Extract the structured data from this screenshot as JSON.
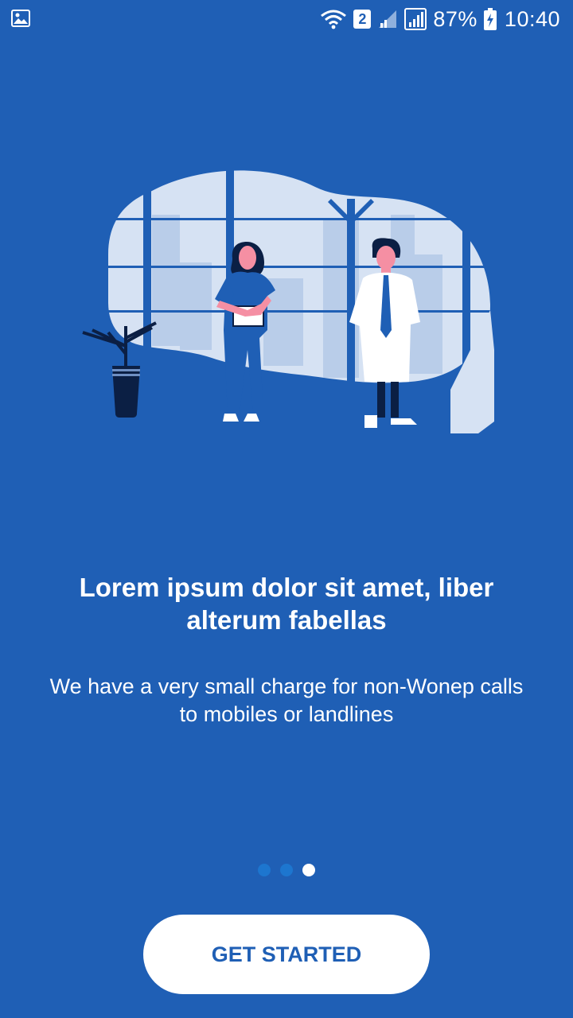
{
  "status_bar": {
    "sim_badge": "2",
    "battery_percent": "87%",
    "time": "10:40",
    "icons": [
      "gallery-icon",
      "wifi-icon",
      "signal-icon",
      "battery-icon"
    ]
  },
  "onboarding": {
    "title": "Lorem ipsum dolor sit amet, liber alterum fabellas",
    "description": "We have a very small charge for non-Wonep calls to mobiles or landlines",
    "page_count": 3,
    "active_page": 3,
    "cta_label": "GET STARTED"
  },
  "colors": {
    "background": "#1f5fb5",
    "accent_white": "#ffffff",
    "inactive_dot": "#1d76cf",
    "illustration_light": "#d6e2f3"
  }
}
